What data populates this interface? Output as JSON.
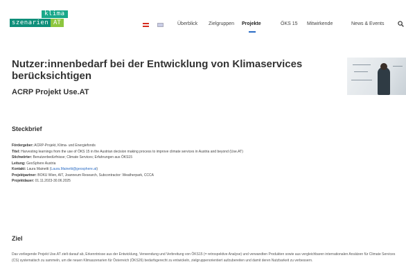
{
  "logo": {
    "line1": "klima",
    "line2": "szenarien",
    "line3": "AT"
  },
  "nav": {
    "items": [
      "Überblick",
      "Zielgruppen",
      "Projekte",
      "ÖKS 15",
      "Mitwirkende",
      "News & Events"
    ],
    "active": "Projekte",
    "flags": [
      "flag-at-icon",
      "flag-uk-icon"
    ]
  },
  "page": {
    "title": "Nutzer:innenbedarf bei der Entwicklung von Klimaservices berücksichtigen",
    "subtitle": "ACRP Projekt Use.AT"
  },
  "steckbrief": {
    "heading": "Steckbrief",
    "rows": [
      {
        "label": "Fördergeber:",
        "value": " ACRP-Projekt, Klima- und Energiefonds"
      },
      {
        "label": "Titel:",
        "value": " Harvesting learnings from the use of ÖKS 15 in the Austrian decision making process to improve climate services in Austria and beyond (Use.AT)"
      },
      {
        "label": "Stichwörter:",
        "value": " Benutzerbedürfnisse; Climate Services; Erfahrungen aus ÖKS15"
      },
      {
        "label": "Leitung:",
        "value": " GeoSphere Austria"
      },
      {
        "label": "Kontakt:",
        "value": " Laura Mainetti (",
        "link": "Laura.Mainetti@geosphere.at",
        "after": ")"
      },
      {
        "label": "Projektpartner:",
        "value": " BOKU Wien, AIT, Joanneum Research, Subcontractor: Weatherpark, CCCA"
      },
      {
        "label": "Projektdauer:",
        "value": " 01.11.2023-30.06.2025"
      }
    ]
  },
  "ziel": {
    "heading": "Ziel",
    "text": "Das vorliegende Projekt Use.AT zielt darauf ab, Erkenntnisse aus der Entwicklung, Verwendung und Verbreitung von ÖKS15 (= retrospektive Analyse) und verwandten Produkten sowie aus vergleichbaren internationalen Ansätzen für Climate Services (CS) systematisch zu sammeln, um die neuen Klimaszenarien für Österreich (ÖKS26) bedarfsgerecht zu entwickeln, zielgruppenorientiert aufzubereiten und damit deren Nutzbarkeit zu verbessern."
  }
}
